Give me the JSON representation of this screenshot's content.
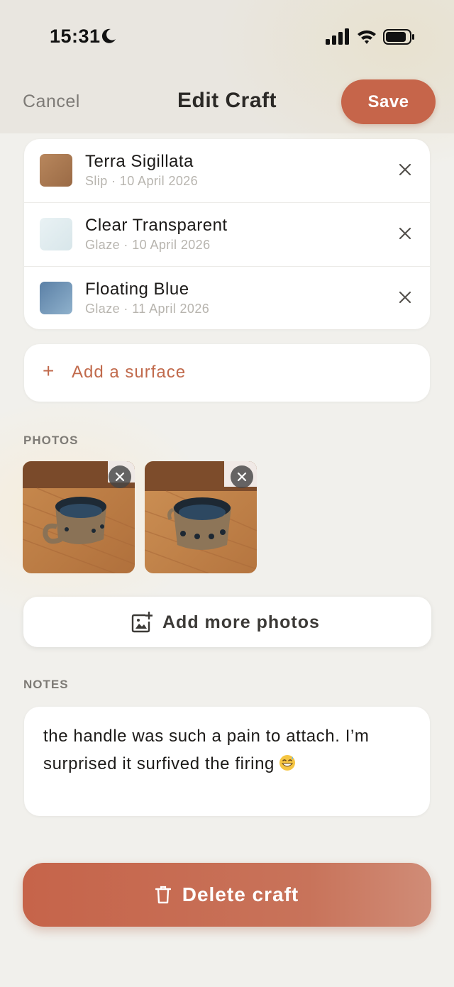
{
  "status_bar": {
    "time": "15:31",
    "icons": [
      "moon-icon",
      "signal-icon",
      "wifi-icon",
      "battery-icon"
    ]
  },
  "nav": {
    "cancel_label": "Cancel",
    "title": "Edit Craft",
    "save_label": "Save"
  },
  "surfaces": [
    {
      "name": "Terra Sigillata",
      "meta": "Slip · 10 April 2026",
      "swatch_color": "#a8764f"
    },
    {
      "name": "Clear Transparent",
      "meta": "Glaze · 10 April 2026",
      "swatch_color": "#e3edf0"
    },
    {
      "name": "Floating Blue",
      "meta": "Glaze · 11 April 2026",
      "swatch_color": "#6a8fb1"
    }
  ],
  "add_surface": {
    "plus": "+",
    "label": "Add a surface"
  },
  "photos_section": {
    "label": "PHOTOS",
    "photos": [
      {
        "subject": "ceramic-mug-with-handle"
      },
      {
        "subject": "ceramic-mug-front"
      }
    ]
  },
  "add_photos": {
    "label": "Add more photos",
    "icon": "add-photo-icon"
  },
  "notes_section": {
    "label": "NOTES",
    "text": "the handle was such a pain to attach. I’m surprised it surfived the firing",
    "emoji": "grinning-sweat-emoji"
  },
  "delete": {
    "label": "Delete craft",
    "icon": "trash-icon"
  },
  "colors": {
    "accent": "#c6654a",
    "background": "#f1f0ec",
    "card": "#ffffff"
  }
}
